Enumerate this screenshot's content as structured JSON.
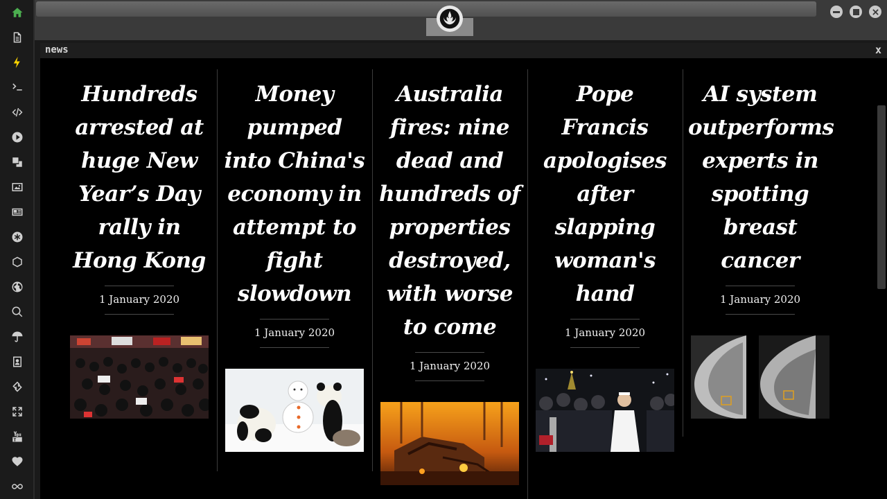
{
  "sidebar": {
    "items": [
      {
        "icon": "home-icon",
        "active": true
      },
      {
        "icon": "document-icon"
      },
      {
        "icon": "bolt-icon"
      },
      {
        "icon": "terminal-icon"
      },
      {
        "icon": "code-icon"
      },
      {
        "icon": "play-icon"
      },
      {
        "icon": "translate-icon"
      },
      {
        "icon": "image-icon"
      },
      {
        "icon": "newspaper-icon"
      },
      {
        "icon": "asterisk-icon"
      },
      {
        "icon": "hexagon-icon"
      },
      {
        "icon": "globe-icon"
      },
      {
        "icon": "search-icon"
      },
      {
        "icon": "umbrella-icon"
      },
      {
        "icon": "contact-card-icon"
      },
      {
        "icon": "link-icon"
      },
      {
        "icon": "expand-icon"
      },
      {
        "icon": "youtube-icon"
      },
      {
        "icon": "heart-icon"
      },
      {
        "icon": "infinity-icon"
      }
    ]
  },
  "panel": {
    "title": "news",
    "close": "x"
  },
  "articles": [
    {
      "headline": "Hundreds arrested at huge New Year’s Day rally in Hong Kong",
      "date": "1 January 2020",
      "image": "crowd-protest-image"
    },
    {
      "headline": "Money pumped into China's economy in attempt to fight slowdown",
      "date": "1 January 2020",
      "image": "pandas-snowman-image"
    },
    {
      "headline": "Australia fires: nine dead and hundreds of properties destroyed, with worse to come",
      "date": "1 January 2020",
      "image": "bushfire-image"
    },
    {
      "headline": "Pope Francis apologises after slapping woman's hand",
      "date": "1 January 2020",
      "image": "pope-crowd-image"
    },
    {
      "headline": "AI system outperforms experts in spotting breast cancer",
      "date": "1 January 2020",
      "image": "mammogram-image"
    }
  ],
  "colors": {
    "background": "#000000",
    "text": "#ffffff",
    "accent_home": "#4caf50",
    "accent_bolt": "#ffd600"
  }
}
